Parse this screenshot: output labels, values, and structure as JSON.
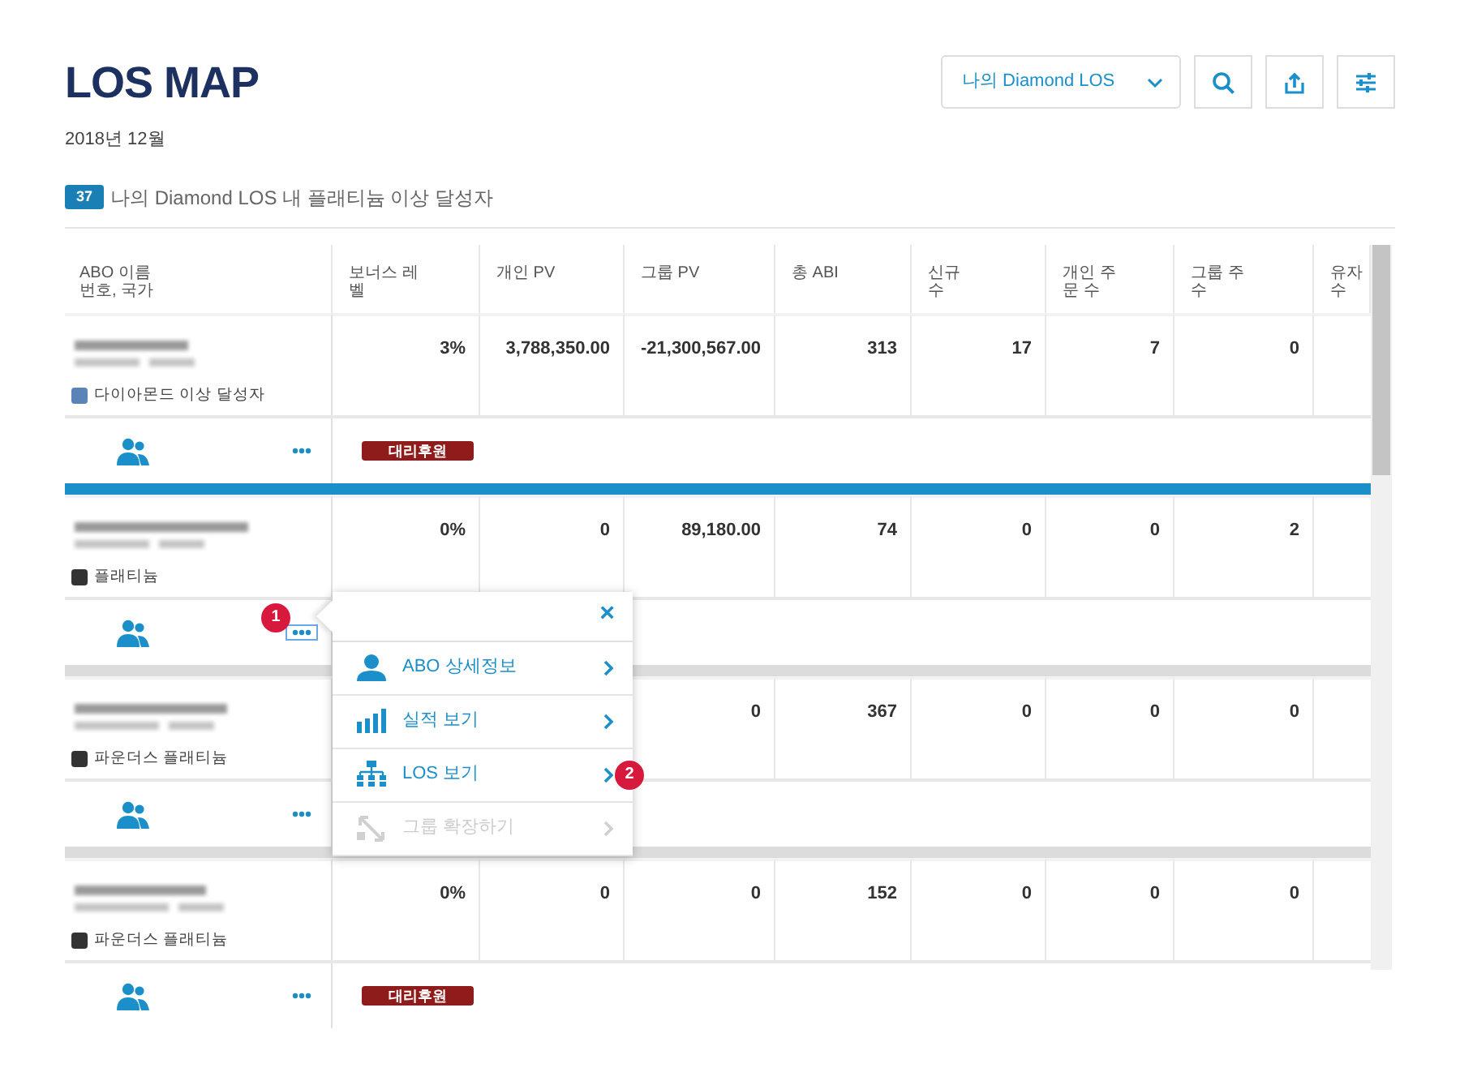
{
  "title": "LOS MAP",
  "period": "2018년 12월",
  "summary": {
    "count": "37",
    "text": "나의 Diamond LOS 내 플래티늄 이상 달성자"
  },
  "toolbar": {
    "dropdown": "나의 Diamond LOS",
    "buttons": [
      {
        "kind": "search"
      },
      {
        "kind": "export"
      },
      {
        "kind": "filter"
      }
    ]
  },
  "table": {
    "columns": [
      {
        "lines": [
          "ABO 이름",
          "번호, 국가"
        ]
      },
      {
        "lines": [
          "보너스 레",
          "벨"
        ]
      },
      {
        "lines": [
          "개인 PV"
        ]
      },
      {
        "lines": [
          "그룹 PV"
        ]
      },
      {
        "lines": [
          "총 ABI"
        ]
      },
      {
        "lines": [
          "신규",
          "수"
        ]
      },
      {
        "lines": [
          "개인 주",
          "문 수"
        ]
      },
      {
        "lines": [
          "그룹 주",
          "수"
        ]
      },
      {
        "lines": [
          "유자",
          "수"
        ]
      }
    ],
    "separators": [
      {
        "highlighted": true
      },
      {
        "highlighted": false
      },
      {
        "highlighted": false
      }
    ],
    "rows": [
      {
        "level": "다이아몬드 이상 달성자",
        "color": "#5a84b8",
        "values": [
          "3%",
          "3,788,350.00",
          "-21,300,567.00",
          "313",
          "17",
          "7",
          "0"
        ],
        "badge": "대리후원",
        "more_selected": false
      },
      {
        "level": "플래티늄",
        "color": "#333333",
        "values": [
          "0%",
          "0",
          "89,180.00",
          "74",
          "0",
          "0",
          "2"
        ],
        "more_selected": true
      },
      {
        "level": "파운더스 플래티늄",
        "color": "#333333",
        "values": [
          "0",
          "367",
          "0",
          "0",
          "0"
        ],
        "more_selected": false
      },
      {
        "level": "파운더스 플래티늄",
        "color": "#333333",
        "values": [
          "0%",
          "0",
          "0",
          "152",
          "0",
          "0",
          "0"
        ],
        "badge": "대리후원",
        "more_selected": false
      }
    ]
  },
  "popup": {
    "close": "×",
    "items": [
      {
        "kind": "person",
        "label": "ABO 상세정보",
        "disabled": false
      },
      {
        "kind": "chart",
        "label": "실적 보기",
        "disabled": false
      },
      {
        "kind": "tree",
        "label": "LOS 보기",
        "disabled": false
      },
      {
        "kind": "expand",
        "label": "그룹 확장하기",
        "disabled": true
      }
    ]
  },
  "callouts": [
    "1",
    "2"
  ]
}
